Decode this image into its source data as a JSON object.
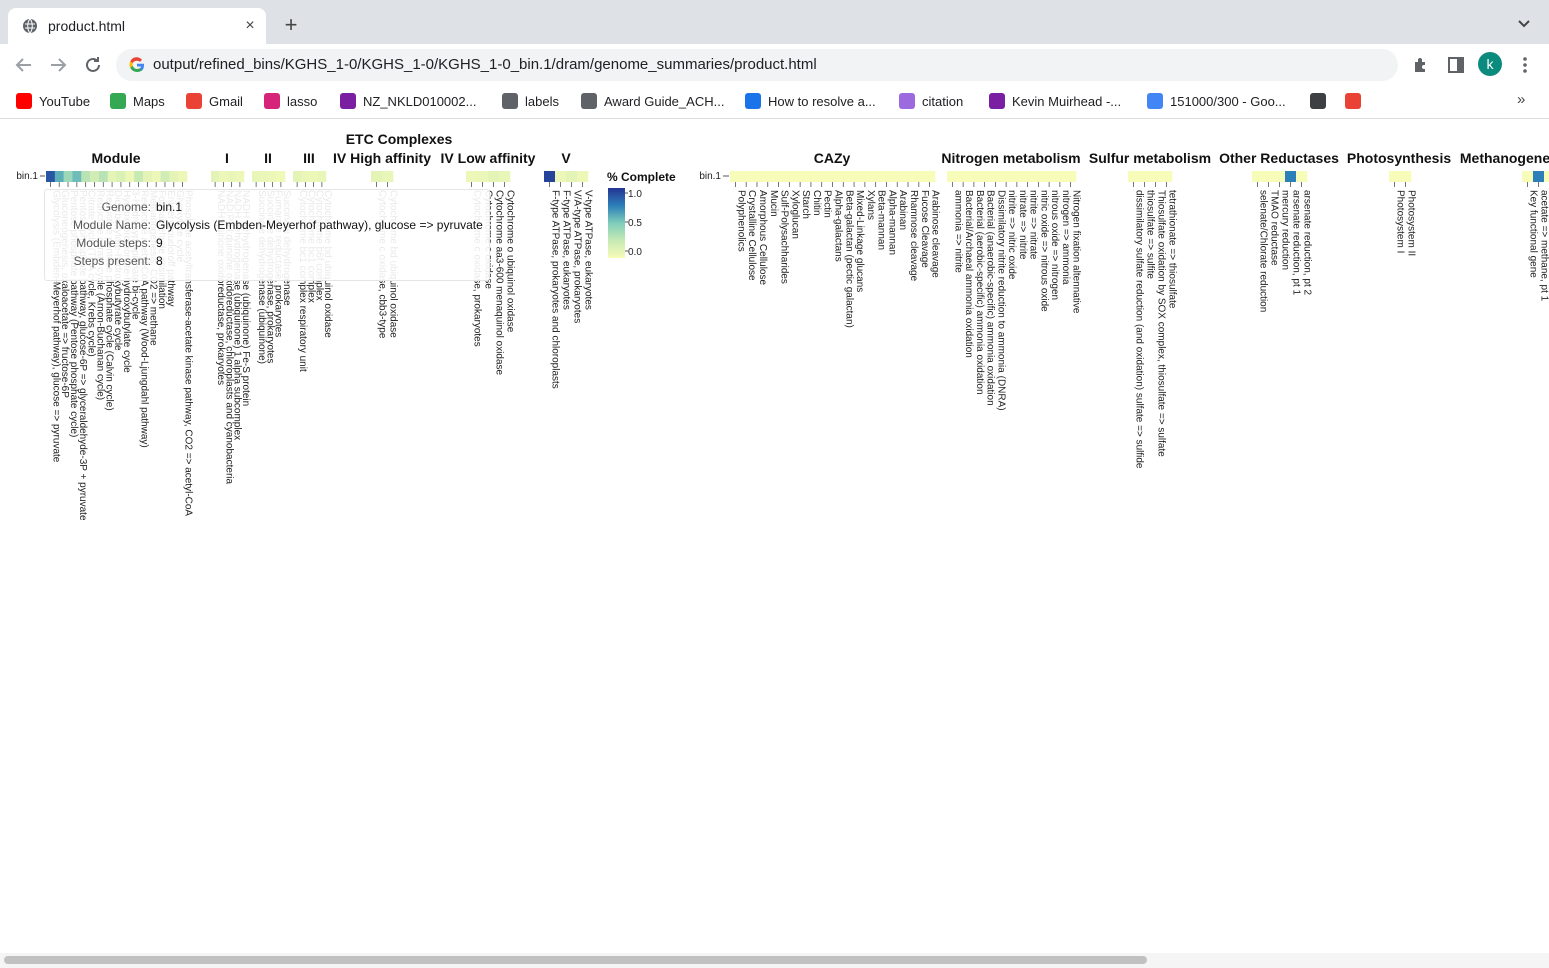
{
  "browser": {
    "tab_title": "product.html",
    "close_glyph": "×",
    "newtab_glyph": "+",
    "url": "output/refined_bins/KGHS_1-0/KGHS_1-0/KGHS_1-0_bin.1/dram/genome_summaries/product.html",
    "profile_letter": "k",
    "more_glyph": "»",
    "bookmarks": [
      {
        "label": "YouTube",
        "color": "#ff0000"
      },
      {
        "label": "Maps",
        "color": "#34a853"
      },
      {
        "label": "Gmail",
        "color": "#ea4335"
      },
      {
        "label": "lasso",
        "color": "#d6247a"
      },
      {
        "label": "NZ_NKLD010002...",
        "color": "#7a1fa2"
      },
      {
        "label": "labels",
        "color": "#5f6368"
      },
      {
        "label": "Award Guide_ACH...",
        "color": "#5f6368"
      },
      {
        "label": "How to resolve a...",
        "color": "#1a73e8"
      },
      {
        "label": "citation",
        "color": "#9c6ade"
      },
      {
        "label": "Kevin Muirhead -...",
        "color": "#7a1fa2"
      },
      {
        "label": "151000/300 - Goo...",
        "color": "#4285f4"
      },
      {
        "label": "",
        "color": "#3c4043"
      },
      {
        "label": "",
        "color": "#ea4335"
      }
    ]
  },
  "heatmap": {
    "row_label": "bin.1",
    "etc_title": "ETC Complexes",
    "legend": {
      "title": "% Complete",
      "ticks": [
        "1.0",
        "0.5",
        "0.0"
      ]
    },
    "sections": [
      {
        "title": "Module"
      },
      {
        "title": "I"
      },
      {
        "title": "II"
      },
      {
        "title": "III"
      },
      {
        "title": "IV High affinity"
      },
      {
        "title": "IV Low affinity"
      },
      {
        "title": "V"
      },
      {
        "title": "CAZy"
      },
      {
        "title": "Nitrogen metabolism"
      },
      {
        "title": "Sulfur metabolism"
      },
      {
        "title": "Other Reductases"
      },
      {
        "title": "Photosynthesis"
      },
      {
        "title": "Methanogene"
      }
    ]
  },
  "chart_data": {
    "type": "heatmap",
    "rows": [
      "bin.1"
    ],
    "colorscale": {
      "low": "#f7fcb9",
      "high": "#253494",
      "range": [
        0,
        1
      ]
    },
    "panels": [
      {
        "name": "Module",
        "columns": [
          "Glycolysis (Embden-Meyerhof pathway), glucose => pyruvate",
          "Gluconeogenesis, oxaloacetate => fructose-6P",
          "Pentose phosphate pathway (Pentose phosphate cycle)",
          "Pentose phosphate pathway, glucose-6P => glyceraldehyde-3P + pyruvate",
          "Citrate cycle (TCA cycle, Krebs cycle)",
          "Reductive citrate cycle (Arnon-Buchanan cycle)",
          "Reductive pentose phosphate cycle (Calvin cycle)",
          "Dicarboxylate-hydroxybutyrate cycle",
          "Hydroxypropionate-hydroxybutylate cycle",
          "3-Hydroxypropionate bi-cycle",
          "Reductive acetyl-CoA pathway (Wood-Ljungdahl pathway)",
          "Methanogenesis, CO2 => methane",
          "Formaldehyde assimilation",
          "Entner-Doudoroff pathway",
          "Glyoxylate cycle",
          "Phosphate acetyltransferase-acetate kinase pathway, CO2 => acetyl-CoA"
        ],
        "values": [
          0.89,
          0.6,
          0.4,
          0.55,
          0.3,
          0.2,
          0.3,
          0.1,
          0.15,
          0.05,
          0.25,
          0.1,
          0.05,
          0.2,
          0.1,
          0.05
        ]
      },
      {
        "name": "I",
        "columns": [
          "NADH:quinone oxidoreductase, prokaryotes",
          "NAD(P)H:quinone oxidoreductase, chloroplasts and cyanobacteria",
          "NADH dehydrogenase (ubiquinone) 1 alpha subcomplex",
          "NADH dehydrogenase (ubiquinone) Fe-S protein"
        ],
        "values": [
          0.1,
          0.05,
          0.08,
          0.05
        ]
      },
      {
        "name": "II",
        "columns": [
          "Succinate dehydrogenase (ubiquinone)",
          "Succinate dehydrogenase, prokaryotes",
          "Fumarate reductase, prokaryotes",
          "Succinate dehydrogenase"
        ],
        "values": [
          0.08,
          0.06,
          0.05,
          0.04
        ]
      },
      {
        "name": "III",
        "columns": [
          "Cytochrome bc1 complex respiratory unit",
          "Cytochrome bc1 complex",
          "Cytochrome b6f complex",
          "Cytochrome bd ubiquinol oxidase"
        ],
        "values": [
          0.1,
          0.06,
          0.05,
          0.08
        ]
      },
      {
        "name": "IV High affinity",
        "columns": [
          "Cytochrome c oxidase, cbb3-type",
          "Cytochrome bd ubiquinol oxidase"
        ],
        "values": [
          0.1,
          0.08
        ]
      },
      {
        "name": "IV Low affinity",
        "columns": [
          "Cytochrome c oxidase, prokaryotes",
          "Cytochrome c oxidase",
          "Cytochrome aa3-600 menaquinol oxidase",
          "Cytochrome o ubiquinol oxidase"
        ],
        "values": [
          0.05,
          0.06,
          0.1,
          0.08
        ]
      },
      {
        "name": "V",
        "columns": [
          "F-type ATPase, prokaryotes and chloroplasts",
          "F-type ATPase, eukaryotes",
          "V/A-type ATPase, prokaryotes",
          "V-type ATPase, eukaryotes"
        ],
        "values": [
          0.95,
          0.05,
          0.1,
          0.05
        ]
      },
      {
        "name": "CAZy",
        "columns": [
          "Polyphenolics",
          "Crystalline Cellulose",
          "Amorphous Cellulose",
          "Mucin",
          "Sulf-Polysachharides",
          "Xyloglucan",
          "Starch",
          "Chitin",
          "Pectin",
          "Alpha-galactans",
          "Beta-galactan (pectic galactan)",
          "Mixed-Linkage glucans",
          "Xylans",
          "Beta-mannan",
          "Alpha-mannan",
          "Arabinan",
          "Rhamnose cleavage",
          "Fucose Cleavage",
          "Arabinose cleavage"
        ],
        "values": [
          0,
          0,
          0,
          0,
          0,
          0,
          0,
          0,
          0,
          0,
          0,
          0,
          0,
          0,
          0,
          0,
          0,
          0,
          0
        ]
      },
      {
        "name": "Nitrogen metabolism",
        "columns": [
          "ammonia => nitrite",
          "Bacterial/Archaeal ammonia oxidation",
          "Bacterial (aerobic-specific) ammonia oxidation",
          "Bacterial (anaerobic-specific) ammonia oxidation",
          "Dissimilatory nitrite reduction to ammonia (DNRA)",
          "nitrite => nitric oxide",
          "nitrate => nitrite",
          "nitrite => nitrate",
          "nitric oxide => nitrous oxide",
          "nitrous oxide => nitrogen",
          "nitrogen => ammonia",
          "Nitrogen fixation altennative"
        ],
        "values": [
          0,
          0,
          0,
          0,
          0,
          0,
          0,
          0,
          0,
          0,
          0,
          0
        ]
      },
      {
        "name": "Sulfur metabolism",
        "columns": [
          "dissimilatory sulfate reduction (and oxidation) sulfate => sulfide",
          "thiosulfate => sulfite",
          "Thiosulfate oxidation by SOX complex, thiosulfate => sulfate",
          "tetrathionate => thiosulfate"
        ],
        "values": [
          0,
          0,
          0,
          0
        ]
      },
      {
        "name": "Other Reductases",
        "columns": [
          "selenate/Chlorate reduction",
          "TMAO reductase",
          "mercury reduction",
          "arsenate reduction, pt 1",
          "arsenate reduction, pt 2"
        ],
        "values": [
          0,
          0,
          0,
          0.75,
          0
        ]
      },
      {
        "name": "Photosynthesis",
        "columns": [
          "Photosystem I",
          "Photosystem II"
        ],
        "values": [
          0,
          0
        ]
      },
      {
        "name": "Methanogene",
        "columns": [
          "Key functional gene",
          "acetate => methane, pt 1",
          "acetate => methane"
        ],
        "values": [
          0,
          0.75,
          0
        ]
      }
    ]
  },
  "tooltip": {
    "genome_key": "Genome:",
    "genome_val": "bin.1",
    "module_key": "Module Name:",
    "module_val": "Glycolysis (Embden-Meyerhof pathway), glucose => pyruvate",
    "steps_key": "Module steps:",
    "steps_val": "9",
    "present_key": "Steps present:",
    "present_val": "8"
  }
}
